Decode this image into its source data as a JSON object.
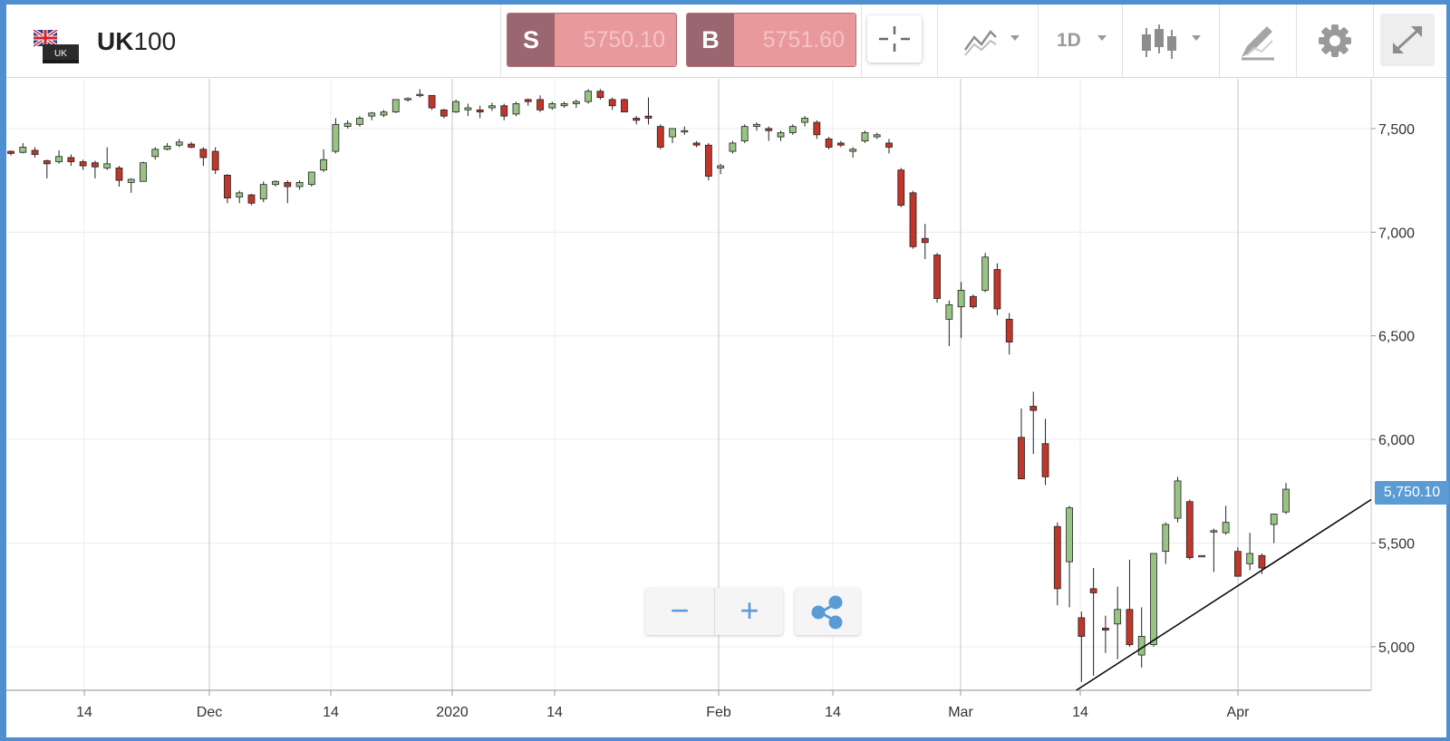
{
  "header": {
    "symbol_base": "UK",
    "symbol_suffix": "100",
    "flag_badge": "UK",
    "sell": {
      "tag": "S",
      "price": "5750.10"
    },
    "buy": {
      "tag": "B",
      "price": "5751.60"
    },
    "timeframe": "1D",
    "icons": {
      "crosshair": "crosshair-icon",
      "indicators": "indicators-icon",
      "chart_type": "candlestick-icon",
      "draw": "draw-tool-icon",
      "settings": "gear-icon",
      "fullscreen": "expand-icon",
      "share": "share-icon"
    }
  },
  "controls": {
    "zoom_out": "−",
    "zoom_in": "+"
  },
  "last_price_label": "5,750.10",
  "colors": {
    "up": "#97c383",
    "down": "#c0362a",
    "accent": "#5b9bd5",
    "sell_dark": "#9a6670",
    "sell_light": "#e8999b"
  },
  "chart_data": {
    "type": "candlestick",
    "ylabels": [
      "7,500",
      "7,000",
      "6,500",
      "6,000",
      "5,500",
      "5,000"
    ],
    "yticks": [
      7500,
      7000,
      6500,
      6000,
      5500,
      5000
    ],
    "xlabels": [
      "14",
      "Dec",
      "14",
      "2020",
      "14",
      "Feb",
      "14",
      "Mar",
      "14",
      "Apr"
    ],
    "ylim": [
      4790,
      7740
    ],
    "grid": true,
    "trendline": [
      [
        0.784,
        4790
      ],
      [
        1.0,
        5710
      ]
    ],
    "candles": [
      [
        7390,
        7395,
        7370,
        7380
      ],
      [
        7385,
        7430,
        7380,
        7410
      ],
      [
        7395,
        7410,
        7360,
        7375
      ],
      [
        7345,
        7350,
        7260,
        7330
      ],
      [
        7340,
        7395,
        7330,
        7365
      ],
      [
        7360,
        7375,
        7320,
        7340
      ],
      [
        7340,
        7350,
        7300,
        7320
      ],
      [
        7335,
        7345,
        7260,
        7315
      ],
      [
        7310,
        7410,
        7300,
        7330
      ],
      [
        7310,
        7320,
        7220,
        7250
      ],
      [
        7240,
        7260,
        7190,
        7255
      ],
      [
        7245,
        7340,
        7245,
        7335
      ],
      [
        7365,
        7410,
        7350,
        7400
      ],
      [
        7400,
        7430,
        7395,
        7415
      ],
      [
        7420,
        7450,
        7410,
        7435
      ],
      [
        7425,
        7435,
        7405,
        7410
      ],
      [
        7400,
        7410,
        7320,
        7360
      ],
      [
        7390,
        7410,
        7280,
        7300
      ],
      [
        7275,
        7280,
        7140,
        7165
      ],
      [
        7170,
        7200,
        7140,
        7190
      ],
      [
        7180,
        7185,
        7130,
        7140
      ],
      [
        7160,
        7245,
        7145,
        7230
      ],
      [
        7230,
        7250,
        7220,
        7245
      ],
      [
        7240,
        7250,
        7140,
        7220
      ],
      [
        7220,
        7250,
        7205,
        7240
      ],
      [
        7230,
        7290,
        7220,
        7290
      ],
      [
        7300,
        7400,
        7290,
        7350
      ],
      [
        7390,
        7550,
        7380,
        7520
      ],
      [
        7510,
        7540,
        7500,
        7525
      ],
      [
        7520,
        7560,
        7510,
        7550
      ],
      [
        7560,
        7580,
        7540,
        7575
      ],
      [
        7565,
        7590,
        7555,
        7580
      ],
      [
        7580,
        7640,
        7575,
        7640
      ],
      [
        7640,
        7650,
        7630,
        7645
      ],
      [
        7660,
        7690,
        7650,
        7665
      ],
      [
        7660,
        7660,
        7590,
        7600
      ],
      [
        7590,
        7595,
        7550,
        7560
      ],
      [
        7580,
        7640,
        7575,
        7630
      ],
      [
        7590,
        7620,
        7560,
        7600
      ],
      [
        7590,
        7610,
        7550,
        7580
      ],
      [
        7600,
        7625,
        7585,
        7610
      ],
      [
        7610,
        7620,
        7540,
        7560
      ],
      [
        7570,
        7630,
        7560,
        7620
      ],
      [
        7640,
        7645,
        7610,
        7630
      ],
      [
        7640,
        7660,
        7580,
        7590
      ],
      [
        7600,
        7630,
        7590,
        7620
      ],
      [
        7610,
        7630,
        7600,
        7620
      ],
      [
        7620,
        7640,
        7600,
        7630
      ],
      [
        7630,
        7690,
        7620,
        7680
      ],
      [
        7680,
        7690,
        7640,
        7650
      ],
      [
        7640,
        7650,
        7590,
        7610
      ],
      [
        7640,
        7645,
        7580,
        7580
      ],
      [
        7550,
        7560,
        7520,
        7540
      ],
      [
        7560,
        7650,
        7520,
        7550
      ],
      [
        7510,
        7520,
        7400,
        7410
      ],
      [
        7460,
        7500,
        7430,
        7500
      ],
      [
        7490,
        7510,
        7470,
        7490
      ],
      [
        7430,
        7440,
        7410,
        7420
      ],
      [
        7420,
        7430,
        7250,
        7270
      ],
      [
        7310,
        7330,
        7280,
        7320
      ],
      [
        7390,
        7440,
        7380,
        7430
      ],
      [
        7440,
        7520,
        7430,
        7510
      ],
      [
        7510,
        7530,
        7490,
        7520
      ],
      [
        7500,
        7510,
        7440,
        7490
      ],
      [
        7460,
        7490,
        7440,
        7480
      ],
      [
        7480,
        7520,
        7470,
        7510
      ],
      [
        7530,
        7560,
        7510,
        7550
      ],
      [
        7530,
        7540,
        7450,
        7470
      ],
      [
        7450,
        7460,
        7400,
        7410
      ],
      [
        7430,
        7440,
        7410,
        7420
      ],
      [
        7390,
        7410,
        7360,
        7400
      ],
      [
        7440,
        7490,
        7430,
        7480
      ],
      [
        7460,
        7480,
        7450,
        7470
      ],
      [
        7430,
        7450,
        7380,
        7410
      ],
      [
        7300,
        7310,
        7120,
        7130
      ],
      [
        7190,
        7200,
        6920,
        6930
      ],
      [
        6970,
        7040,
        6870,
        6950
      ],
      [
        6890,
        6900,
        6660,
        6680
      ],
      [
        6580,
        6670,
        6450,
        6650
      ],
      [
        6640,
        6760,
        6490,
        6720
      ],
      [
        6690,
        6700,
        6630,
        6640
      ],
      [
        6720,
        6900,
        6710,
        6880
      ],
      [
        6820,
        6850,
        6600,
        6630
      ],
      [
        6580,
        6610,
        6410,
        6470
      ],
      [
        6010,
        6150,
        5810,
        5810
      ],
      [
        6160,
        6230,
        5930,
        6140
      ],
      [
        5980,
        6100,
        5780,
        5820
      ],
      [
        5580,
        5600,
        5200,
        5280
      ],
      [
        5410,
        5680,
        5190,
        5670
      ],
      [
        5140,
        5170,
        4830,
        5050
      ],
      [
        5280,
        5380,
        4860,
        5260
      ],
      [
        5090,
        5150,
        4970,
        5080
      ],
      [
        5110,
        5290,
        4940,
        5180
      ],
      [
        5180,
        5420,
        5000,
        5010
      ],
      [
        4960,
        5190,
        4900,
        5050
      ],
      [
        5010,
        5450,
        5000,
        5450
      ],
      [
        5460,
        5600,
        5400,
        5590
      ],
      [
        5620,
        5820,
        5600,
        5800
      ],
      [
        5700,
        5710,
        5420,
        5430
      ],
      [
        5440,
        5440,
        5440,
        5440
      ],
      [
        5560,
        5570,
        5360,
        5560
      ],
      [
        5550,
        5680,
        5540,
        5600
      ],
      [
        5460,
        5480,
        5340,
        5340
      ],
      [
        5400,
        5550,
        5370,
        5450
      ],
      [
        5440,
        5450,
        5350,
        5380
      ],
      [
        5590,
        5640,
        5500,
        5640
      ],
      [
        5650,
        5790,
        5640,
        5760
      ]
    ]
  }
}
